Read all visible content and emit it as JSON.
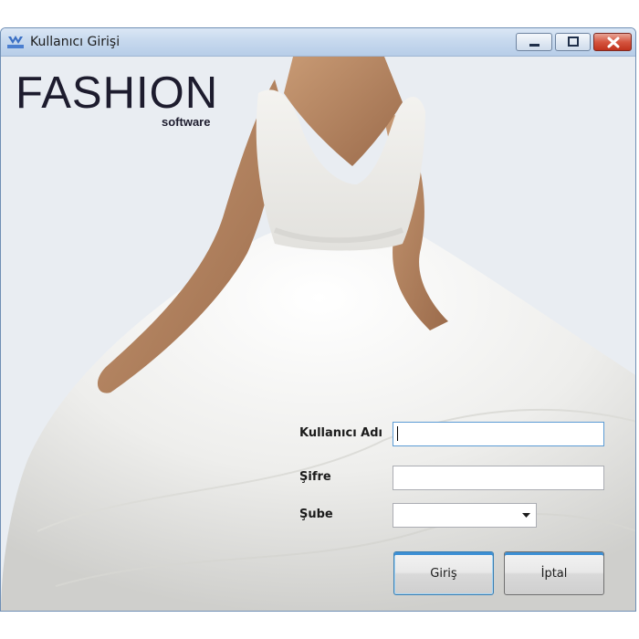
{
  "window": {
    "title": "Kullanıcı Girişi",
    "icon": "app-logo-icon"
  },
  "titlebar_buttons": {
    "minimize_icon": "minimize-icon",
    "maximize_icon": "maximize-icon",
    "close_icon": "close-icon",
    "close_color": "#c0321d"
  },
  "branding": {
    "logo": "FASHION",
    "subtitle": "software"
  },
  "form": {
    "username_label": "Kullanıcı Adı",
    "username_value": "",
    "password_label": "Şifre",
    "password_value": "",
    "branch_label": "Şube",
    "branch_value": ""
  },
  "buttons": {
    "login_label": "Giriş",
    "cancel_label": "İptal"
  },
  "colors": {
    "focus_accent": "#3c8fd4",
    "logo_text": "#1d1c2e"
  }
}
